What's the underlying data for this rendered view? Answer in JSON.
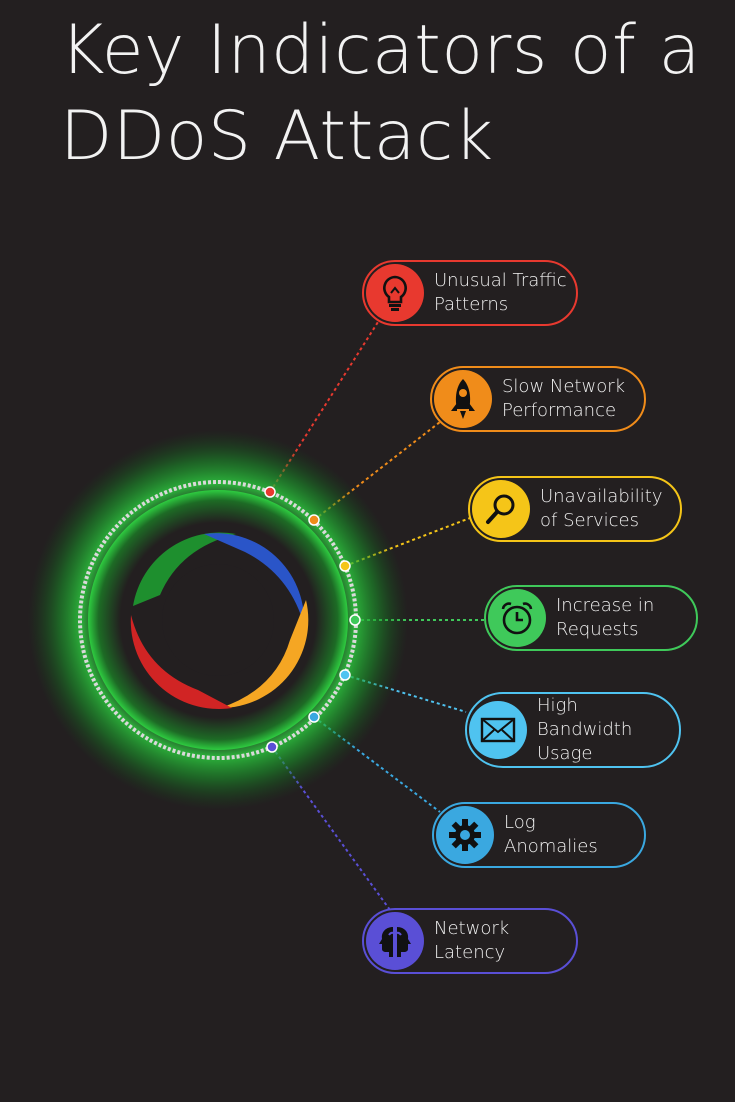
{
  "title": {
    "line1": "Key Indicators of a",
    "line2": "DDoS Attack"
  },
  "indicators": [
    {
      "line1": "Unusual Traffic",
      "line2": "Patterns",
      "color": "#e8392f",
      "icon": "lightbulb-icon"
    },
    {
      "line1": "Slow Network",
      "line2": "Performance",
      "color": "#f08c1a",
      "icon": "rocket-icon"
    },
    {
      "line1": "Unavailability",
      "line2": "of Services",
      "color": "#f5c518",
      "icon": "magnifier-icon"
    },
    {
      "line1": "Increase in",
      "line2": "Requests",
      "color": "#3fc95a",
      "icon": "alarm-clock-icon"
    },
    {
      "line1": "High",
      "line2": "Bandwidth",
      "line3": "Usage",
      "color": "#4fc3f0",
      "icon": "envelope-icon"
    },
    {
      "line1": "Log",
      "line2": "Anomalies",
      "color": "#3aa8e0",
      "icon": "gear-icon"
    },
    {
      "line1": "Network",
      "line2": "Latency",
      "color": "#5a4fd6",
      "icon": "heads-icon"
    }
  ],
  "hub": {
    "ring_color": "#2ecc40",
    "logo_colors": [
      "#1e8f2e",
      "#2a55c8",
      "#f5a623",
      "#d12424"
    ]
  }
}
